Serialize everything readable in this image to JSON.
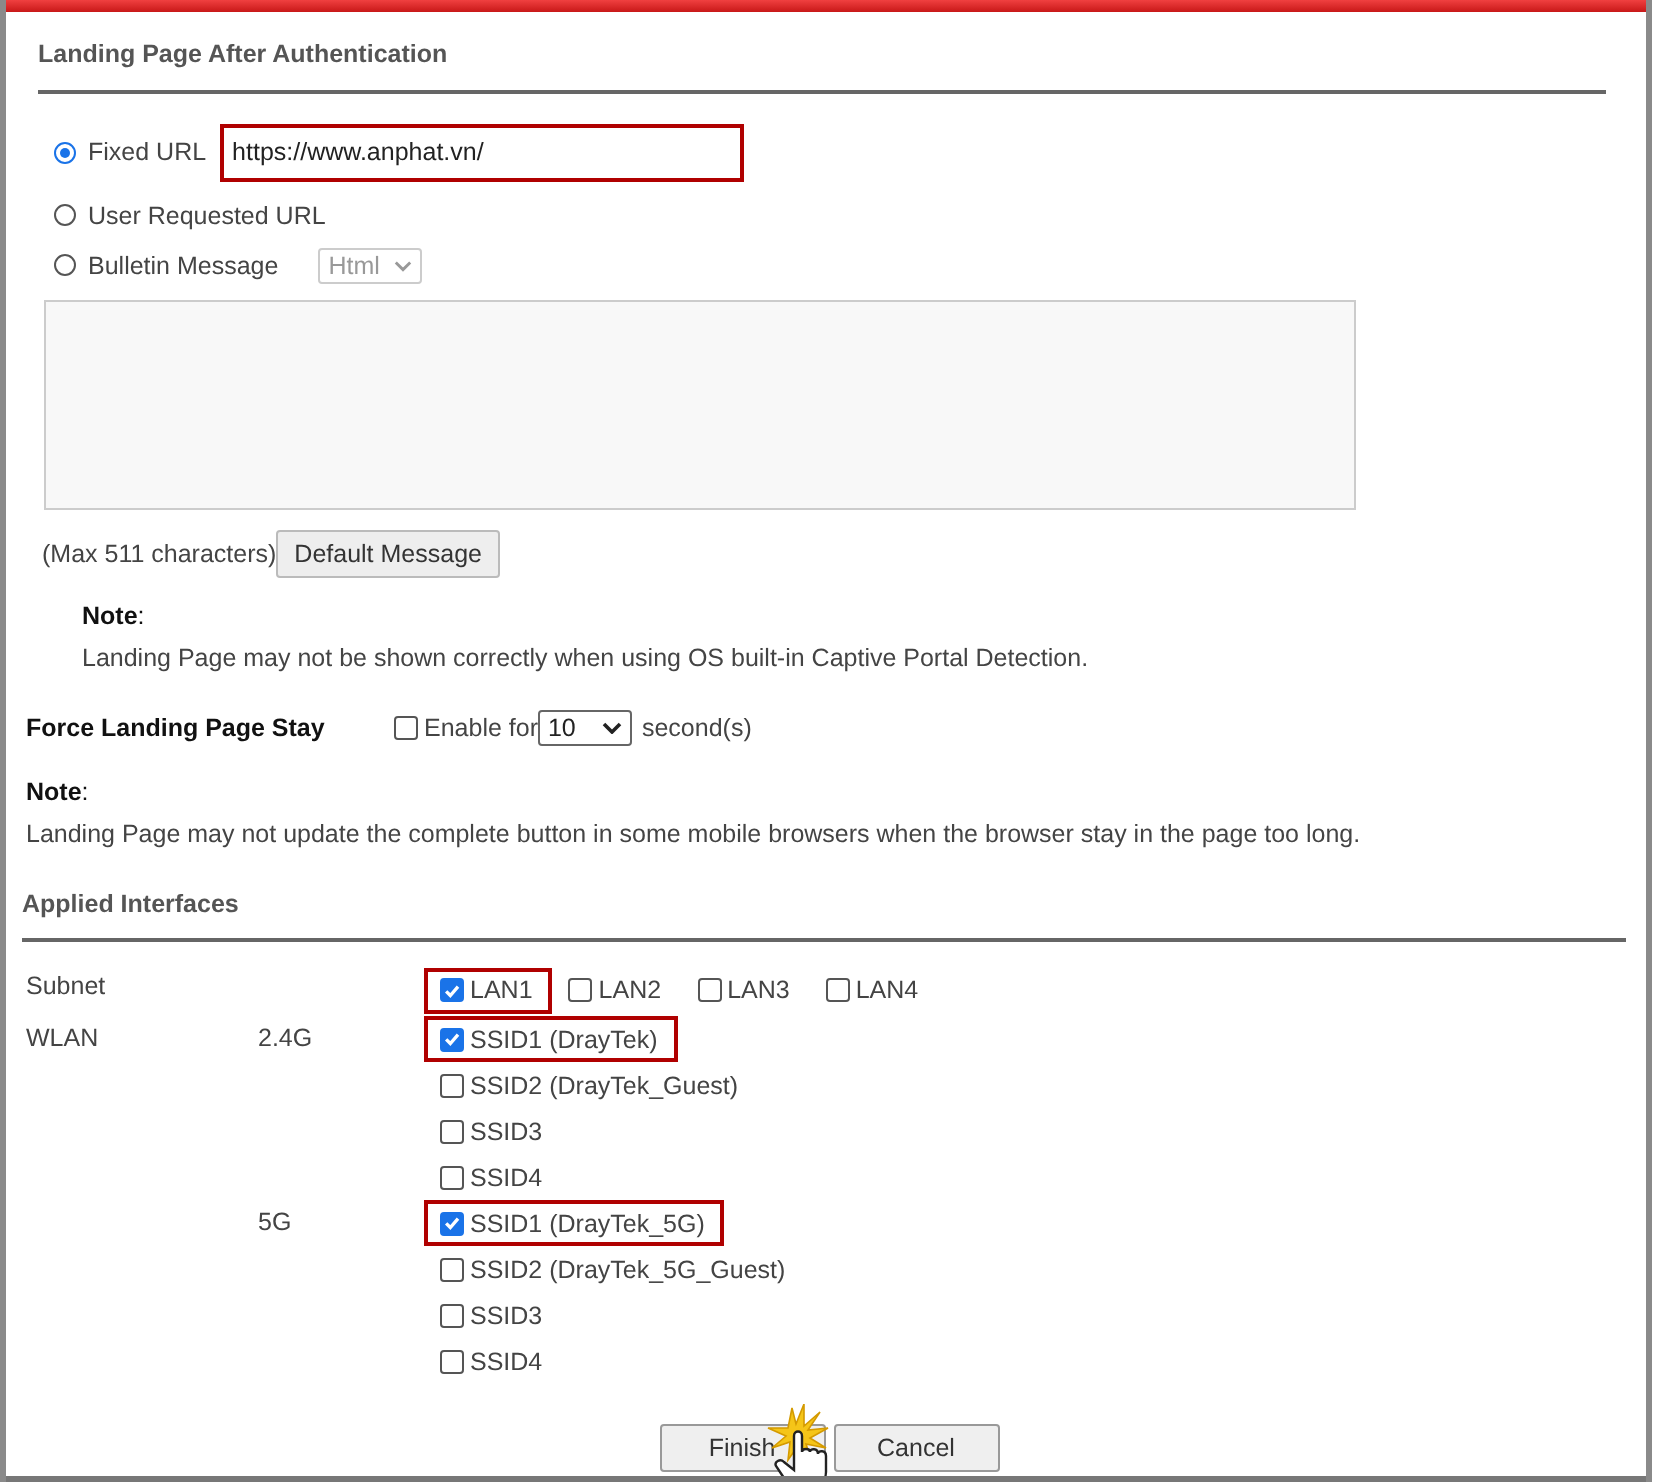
{
  "landing": {
    "title": "Landing Page After Authentication",
    "options": [
      {
        "kind": "url",
        "label": "Fixed URL",
        "selected": true
      },
      {
        "kind": "plain",
        "label": "User Requested URL",
        "selected": false
      },
      {
        "kind": "bulletin",
        "label": "Bulletin Message",
        "selected": false
      }
    ],
    "url": {
      "value": "https://www.anphat.vn/",
      "highlighted": true
    },
    "format": "Html",
    "max_text": "(Max 511 characters)",
    "default_button": "Default Message",
    "note_title": "**Note**:",
    "note_text": "Landing Page may not be shown correctly when using OS built-in Captive Portal Detection."
  },
  "force_stay": {
    "label": "Force Landing Page Stay",
    "checked": false,
    "enable_label": "Enable for",
    "seconds": "10",
    "unit": "second(s)"
  },
  "note": {
    "title": "**Note**:",
    "text": "Landing Page may not update the complete button in some mobile browsers when the browser stay in the page too long."
  },
  "interfaces": {
    "title": "Applied Interfaces",
    "subnet": {
      "label": "Subnet",
      "items": [
        {
          "label": "LAN1",
          "checked": true,
          "highlighted": true
        },
        {
          "label": "LAN2",
          "checked": false,
          "highlighted": false
        },
        {
          "label": "LAN3",
          "checked": false,
          "highlighted": false
        },
        {
          "label": "LAN4",
          "checked": false,
          "highlighted": false
        }
      ]
    },
    "wlan": {
      "label": "WLAN",
      "bands": [
        {
          "band": "2.4G",
          "ssids": [
            {
              "label": "SSID1 (DrayTek)",
              "checked": true,
              "highlighted": true
            },
            {
              "label": "SSID2 (DrayTek_Guest)",
              "checked": false,
              "highlighted": false
            },
            {
              "label": "SSID3",
              "checked": false,
              "highlighted": false
            },
            {
              "label": "SSID4",
              "checked": false,
              "highlighted": false
            }
          ]
        },
        {
          "band": "5G",
          "ssids": [
            {
              "label": "SSID1 (DrayTek_5G)",
              "checked": true,
              "highlighted": true
            },
            {
              "label": "SSID2 (DrayTek_5G_Guest)",
              "checked": false,
              "highlighted": false
            },
            {
              "label": "SSID3",
              "checked": false,
              "highlighted": false
            },
            {
              "label": "SSID4",
              "checked": false,
              "highlighted": false
            }
          ]
        }
      ]
    }
  },
  "buttons": [
    {
      "label": "Finish",
      "kind": "finish"
    },
    {
      "label": "Cancel",
      "kind": "cancel"
    }
  ]
}
